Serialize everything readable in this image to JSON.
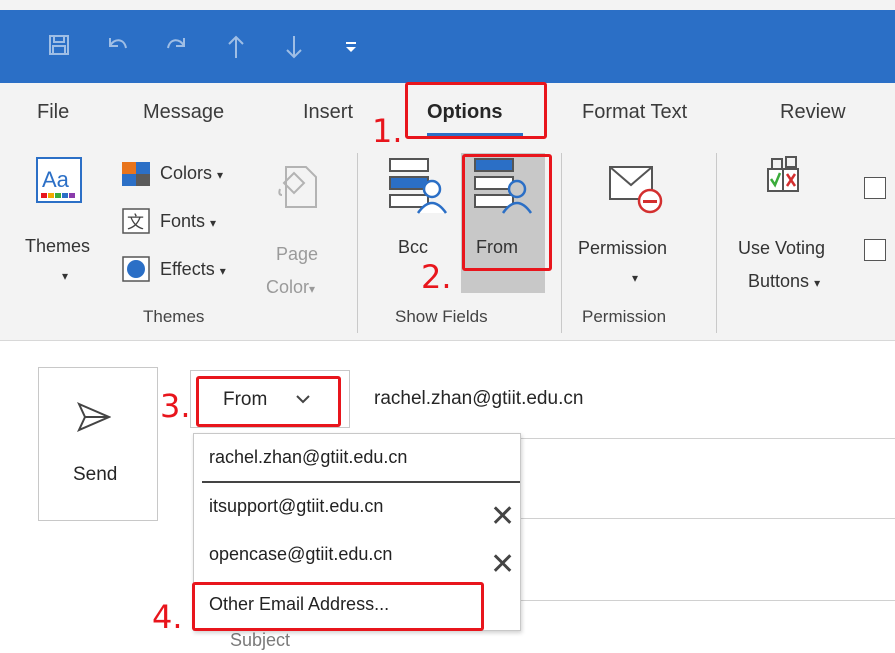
{
  "quick_access": {
    "icons": [
      "save-icon",
      "undo-icon",
      "redo-icon",
      "up-arrow-icon",
      "down-arrow-icon",
      "customize-icon"
    ]
  },
  "tabs": [
    {
      "label": "File"
    },
    {
      "label": "Message"
    },
    {
      "label": "Insert"
    },
    {
      "label": "Options",
      "active": true
    },
    {
      "label": "Format Text"
    },
    {
      "label": "Review"
    }
  ],
  "ribbon": {
    "themes_group": {
      "themes_label": "Themes",
      "colors_label": "Colors",
      "fonts_label": "Fonts",
      "effects_label": "Effects",
      "page_color_line1": "Page",
      "page_color_line2": "Color",
      "group_label": "Themes"
    },
    "show_fields_group": {
      "bcc_label": "Bcc",
      "from_label": "From",
      "group_label": "Show Fields"
    },
    "permission_group": {
      "permission_label": "Permission",
      "group_label": "Permission"
    },
    "tracking_group": {
      "voting_line1": "Use Voting",
      "voting_line2": "Buttons"
    }
  },
  "compose": {
    "send_label": "Send",
    "from_button_label": "From",
    "from_value": "rachel.zhan@gtiit.edu.cn",
    "subject_label": "Subject",
    "from_dropdown": [
      {
        "email": "rachel.zhan@gtiit.edu.cn",
        "removable": false
      },
      {
        "email": "itsupport@gtiit.edu.cn",
        "removable": true
      },
      {
        "email": "opencase@gtiit.edu.cn",
        "removable": true
      }
    ],
    "other_address_label": "Other Email Address..."
  },
  "annotations": {
    "steps": [
      "1.",
      "2.",
      "3.",
      "4."
    ],
    "highlight_color": "#e8151c"
  },
  "colors": {
    "title_bar": "#2b6fc6",
    "ribbon_bg": "#f3f3f3",
    "selected_button": "#c8c8c8"
  }
}
